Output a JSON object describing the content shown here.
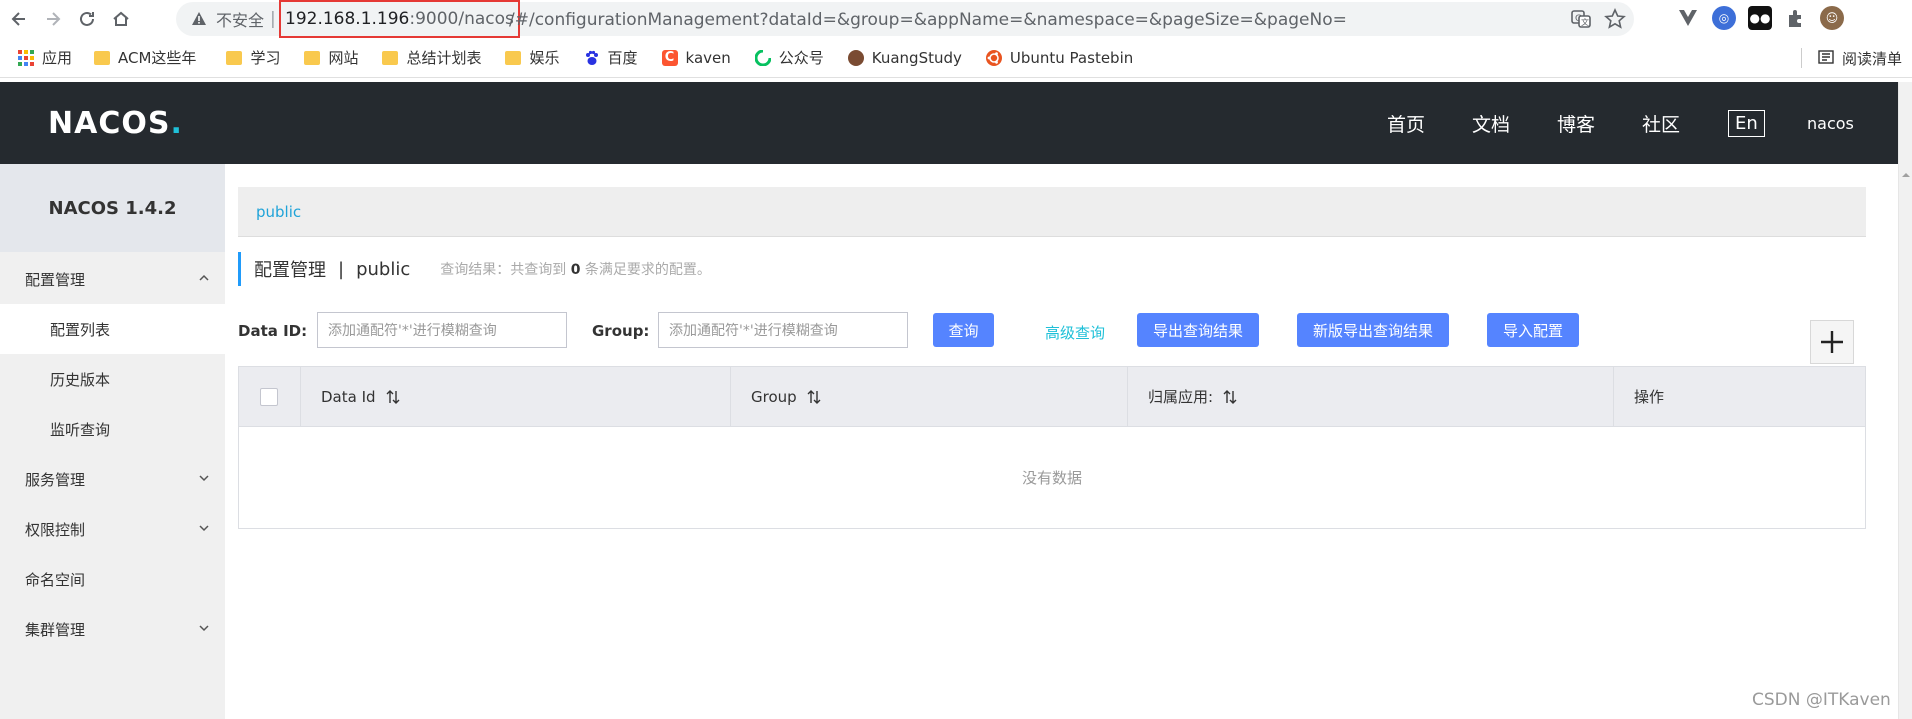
{
  "browser": {
    "insecure_label": "不安全",
    "url_host": "192.168.1.196",
    "url_port_path": ":9000/nacos",
    "url_rest": "/#/configurationManagement?dataId=&group=&appName=&namespace=&pageSize=&pageNo=",
    "bookmarks": [
      {
        "label": "应用",
        "icon": "apps-grid-icon"
      },
      {
        "label": "ACM这些年",
        "icon": "folder-icon"
      },
      {
        "label": "学习",
        "icon": "folder-icon"
      },
      {
        "label": "网站",
        "icon": "folder-icon"
      },
      {
        "label": "总结计划表",
        "icon": "folder-icon"
      },
      {
        "label": "娱乐",
        "icon": "folder-icon"
      },
      {
        "label": "百度",
        "icon": "baidu-paw-icon"
      },
      {
        "label": "kaven",
        "icon": "csdn-c-icon"
      },
      {
        "label": "公众号",
        "icon": "wechat-s-icon"
      },
      {
        "label": "KuangStudy",
        "icon": "avatar-icon"
      },
      {
        "label": "Ubuntu Pastebin",
        "icon": "ubuntu-icon"
      }
    ],
    "reading_list": "阅读清单"
  },
  "header": {
    "logo_text": "NACOS",
    "logo_dot": ".",
    "nav": [
      "首页",
      "文档",
      "博客",
      "社区"
    ],
    "lang": "En",
    "user": "nacos"
  },
  "sidebar": {
    "title": "NACOS 1.4.2",
    "items": [
      {
        "label": "配置管理",
        "type": "group",
        "expanded": true
      },
      {
        "label": "配置列表",
        "type": "sub",
        "active": true
      },
      {
        "label": "历史版本",
        "type": "sub"
      },
      {
        "label": "监听查询",
        "type": "sub"
      },
      {
        "label": "服务管理",
        "type": "group"
      },
      {
        "label": "权限控制",
        "type": "group"
      },
      {
        "label": "命名空间",
        "type": "plain"
      },
      {
        "label": "集群管理",
        "type": "group"
      }
    ]
  },
  "main": {
    "namespace_tab": "public",
    "title": "配置管理",
    "title_sep": "|",
    "namespace": "public",
    "summary_prefix": "查询结果：共查询到",
    "summary_count": "0",
    "summary_suffix": "条满足要求的配置。",
    "data_id_label": "Data ID:",
    "data_id_placeholder": "添加通配符'*'进行模糊查询",
    "group_label": "Group:",
    "group_placeholder": "添加通配符'*'进行模糊查询",
    "query_btn": "查询",
    "advanced_query": "高级查询",
    "export_btn": "导出查询结果",
    "export_new_btn": "新版导出查询结果",
    "import_btn": "导入配置",
    "table_headers": [
      "Data Id",
      "Group",
      "归属应用:",
      "操作"
    ],
    "empty_text": "没有数据"
  },
  "watermark": "CSDN @ITKaven",
  "colors": {
    "header_bg": "#252a2f",
    "primary": "#5584ff",
    "link": "#1fc0d8",
    "highlight_border": "#e53935"
  }
}
